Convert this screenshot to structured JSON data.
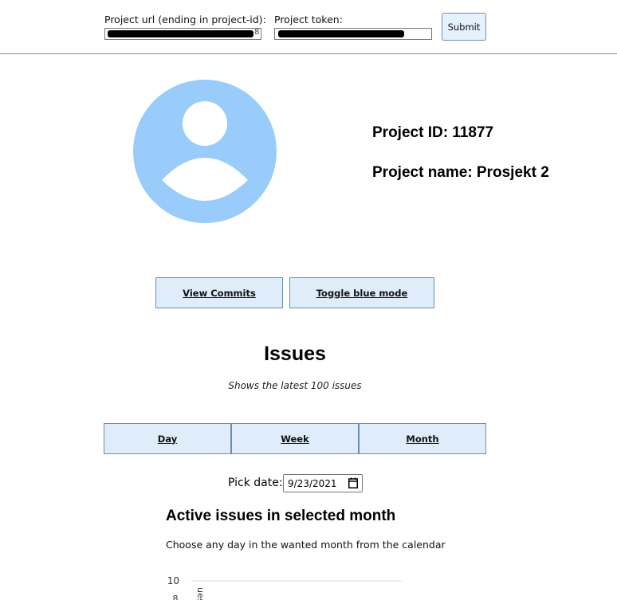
{
  "form": {
    "url_label": "Project url (ending in project-id):",
    "token_label": "Project token:",
    "url_value_visible": "8",
    "submit_label": "Submit"
  },
  "project": {
    "id_text": "Project ID: 11877",
    "name_text": "Project name: Prosjekt 2"
  },
  "actions": {
    "view_commits": "View Commits",
    "toggle_blue": "Toggle blue mode"
  },
  "issues": {
    "title": "Issues",
    "subtitle": "Shows the latest 100 issues",
    "tabs": [
      "Day",
      "Week",
      "Month"
    ]
  },
  "date_picker": {
    "label": "Pick date:",
    "value": "9/23/2021"
  },
  "section": {
    "title": "Active issues in selected month",
    "description": "Choose any day in the wanted month from the calendar"
  },
  "chart_data": {
    "type": "bar",
    "title": "",
    "xlabel": "",
    "ylabel": "ues",
    "yticks": [
      "10"
    ],
    "categories": [],
    "values": []
  },
  "colors": {
    "avatar": "#99ccfb",
    "button_bg": "#deedf9",
    "button_border": "#6d8cb0"
  }
}
